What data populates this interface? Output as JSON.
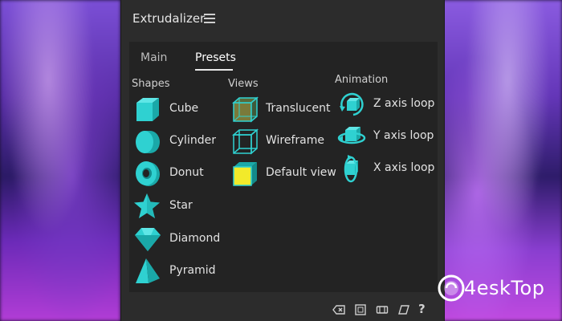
{
  "panel": {
    "title": "Extrudalizer",
    "tabs": [
      "Main",
      "Presets"
    ],
    "active_tab": "Presets"
  },
  "presets": {
    "shapes": {
      "heading": "Shapes",
      "items": [
        {
          "label": "Cube",
          "icon": "cube-icon"
        },
        {
          "label": "Cylinder",
          "icon": "cylinder-icon"
        },
        {
          "label": "Donut",
          "icon": "donut-icon"
        },
        {
          "label": "Star",
          "icon": "star-icon"
        },
        {
          "label": "Diamond",
          "icon": "diamond-icon"
        },
        {
          "label": "Pyramid",
          "icon": "pyramid-icon"
        }
      ]
    },
    "views": {
      "heading": "Views",
      "items": [
        {
          "label": "Translucent",
          "icon": "translucent-cube-icon"
        },
        {
          "label": "Wireframe",
          "icon": "wireframe-cube-icon"
        },
        {
          "label": "Default view",
          "icon": "default-view-cube-icon"
        }
      ]
    },
    "animation": {
      "heading": "Animation",
      "items": [
        {
          "label": "Z axis loop",
          "icon": "z-axis-loop-icon"
        },
        {
          "label": "Y axis loop",
          "icon": "y-axis-loop-icon"
        },
        {
          "label": "X axis loop",
          "icon": "x-axis-loop-icon"
        }
      ]
    }
  },
  "footer": {
    "icons": [
      "backspace-icon",
      "square-icon",
      "layers-icon",
      "perspective-icon",
      "help-icon"
    ],
    "help_label": "?"
  },
  "watermark": {
    "text": "4eskTop"
  },
  "colors": {
    "accent": "#2fd1d1",
    "panel_bg": "#2c2c2c",
    "content_bg": "#232323",
    "text": "#e2e2e2"
  }
}
